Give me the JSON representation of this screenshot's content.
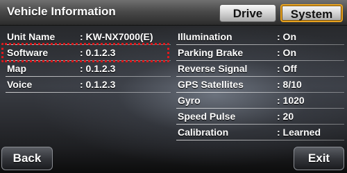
{
  "header": {
    "title": "Vehicle Information",
    "tabs": [
      {
        "label": "Drive",
        "selected": false
      },
      {
        "label": "System",
        "selected": true
      }
    ]
  },
  "left_info": [
    {
      "label": "Unit Name",
      "value": ": KW-NX7000(E)"
    },
    {
      "label": "Software",
      "value": ": 0.1.2.3"
    },
    {
      "label": "Map",
      "value": ": 0.1.2.3"
    },
    {
      "label": "Voice",
      "value": ": 0.1.2.3"
    }
  ],
  "right_info": [
    {
      "label": "Illumination",
      "value": ": On"
    },
    {
      "label": "Parking Brake",
      "value": ": On"
    },
    {
      "label": "Reverse Signal",
      "value": ": Off"
    },
    {
      "label": "GPS Satellites",
      "value": ": 8/10"
    },
    {
      "label": "Gyro",
      "value": ": 1020"
    },
    {
      "label": "Speed Pulse",
      "value": ": 20"
    },
    {
      "label": "Calibration",
      "value": ": Learned"
    }
  ],
  "footer": {
    "back_label": "Back",
    "exit_label": "Exit"
  },
  "colors": {
    "selected_tab_border": "#e8a320",
    "highlight_box": "#e0191c"
  }
}
